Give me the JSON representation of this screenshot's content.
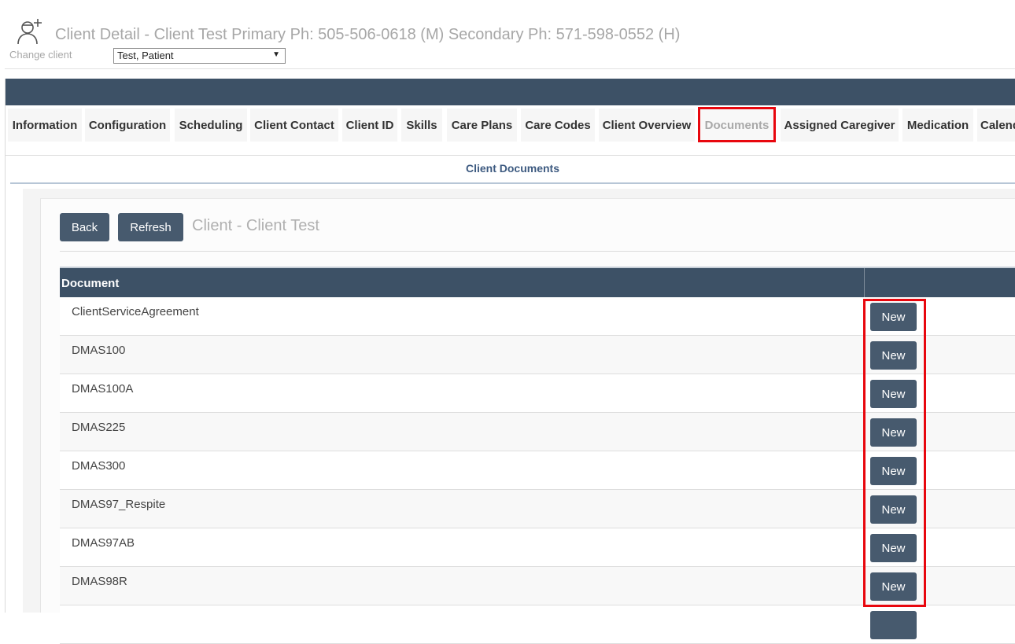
{
  "header": {
    "title": "Client Detail - Client Test Primary Ph: 505-506-0618 (M) Secondary Ph: 571-598-0552 (H)",
    "change_client_label": "Change client",
    "client_select_value": "Test, Patient"
  },
  "tabs": [
    {
      "label": "Information"
    },
    {
      "label": "Configuration"
    },
    {
      "label": "Scheduling"
    },
    {
      "label": "Client Contact"
    },
    {
      "label": "Client ID"
    },
    {
      "label": "Skills"
    },
    {
      "label": "Care Plans"
    },
    {
      "label": "Care Codes"
    },
    {
      "label": "Client Overview"
    },
    {
      "label": "Documents",
      "active": true
    },
    {
      "label": "Assigned Caregiver"
    },
    {
      "label": "Medication"
    },
    {
      "label": "Calendar"
    }
  ],
  "section": {
    "title": "Client Documents"
  },
  "panel": {
    "back_label": "Back",
    "refresh_label": "Refresh",
    "subtitle": "Client - Client Test"
  },
  "table": {
    "header_document": "Document",
    "new_label": "New",
    "rows": [
      {
        "name": "ClientServiceAgreement"
      },
      {
        "name": "DMAS100"
      },
      {
        "name": "DMAS100A"
      },
      {
        "name": "DMAS225"
      },
      {
        "name": "DMAS300"
      },
      {
        "name": "DMAS97_Respite"
      },
      {
        "name": "DMAS97AB"
      },
      {
        "name": "DMAS98R"
      }
    ]
  },
  "colors": {
    "navbar": "#3d5166",
    "button": "#475a6e",
    "highlight": "#e8070e",
    "section_title": "#3d5a80"
  }
}
